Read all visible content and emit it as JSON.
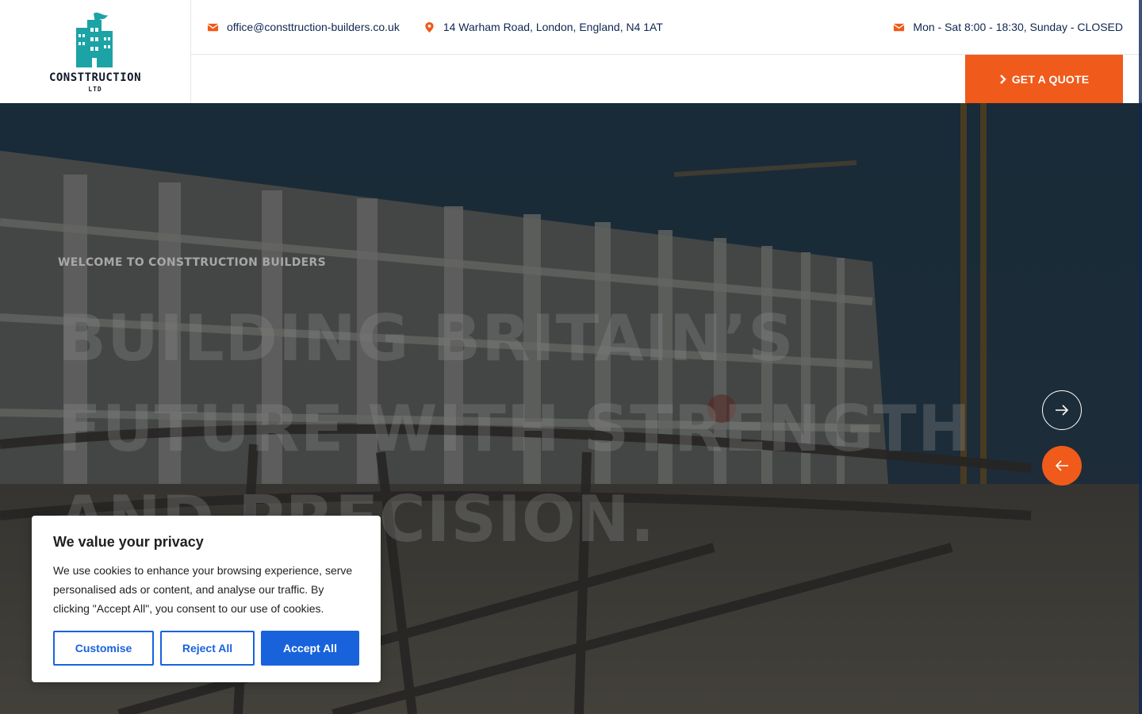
{
  "brand": {
    "logo_name": "CONSTTRUCTION",
    "logo_sub": "LTD",
    "accent": "#f05a1a",
    "navy": "#0f2750",
    "logo_teal": "#1ba3a6"
  },
  "topbar": {
    "email": "office@consttruction-builders.co.uk",
    "email_icon": "envelope-icon",
    "address": "14 Warham Road, London, England, N4 1AT",
    "address_icon": "map-pin-icon",
    "hours": "Mon - Sat 8:00 - 18:30, Sunday - CLOSED",
    "hours_icon": "envelope-icon"
  },
  "nav": {
    "quote_label": "GET A QUOTE",
    "quote_icon": "chevron-right-icon"
  },
  "hero": {
    "welcome": "WELCOME TO CONSTTRUCTION BUILDERS",
    "headline_lines": [
      "BUILDING BRITAIN’S",
      "FUTURE WITH STRENGTH",
      "AND PRECISION."
    ],
    "next_icon": "arrow-right-icon",
    "prev_icon": "arrow-left-icon"
  },
  "cookie": {
    "title": "We value your privacy",
    "text": "We use cookies to enhance your browsing experience, serve personalised ads or content, and analyse our traffic. By clicking \"Accept All\", you consent to our use of cookies.",
    "customise_label": "Customise",
    "reject_label": "Reject All",
    "accept_label": "Accept All",
    "button_color": "#1863dc"
  }
}
